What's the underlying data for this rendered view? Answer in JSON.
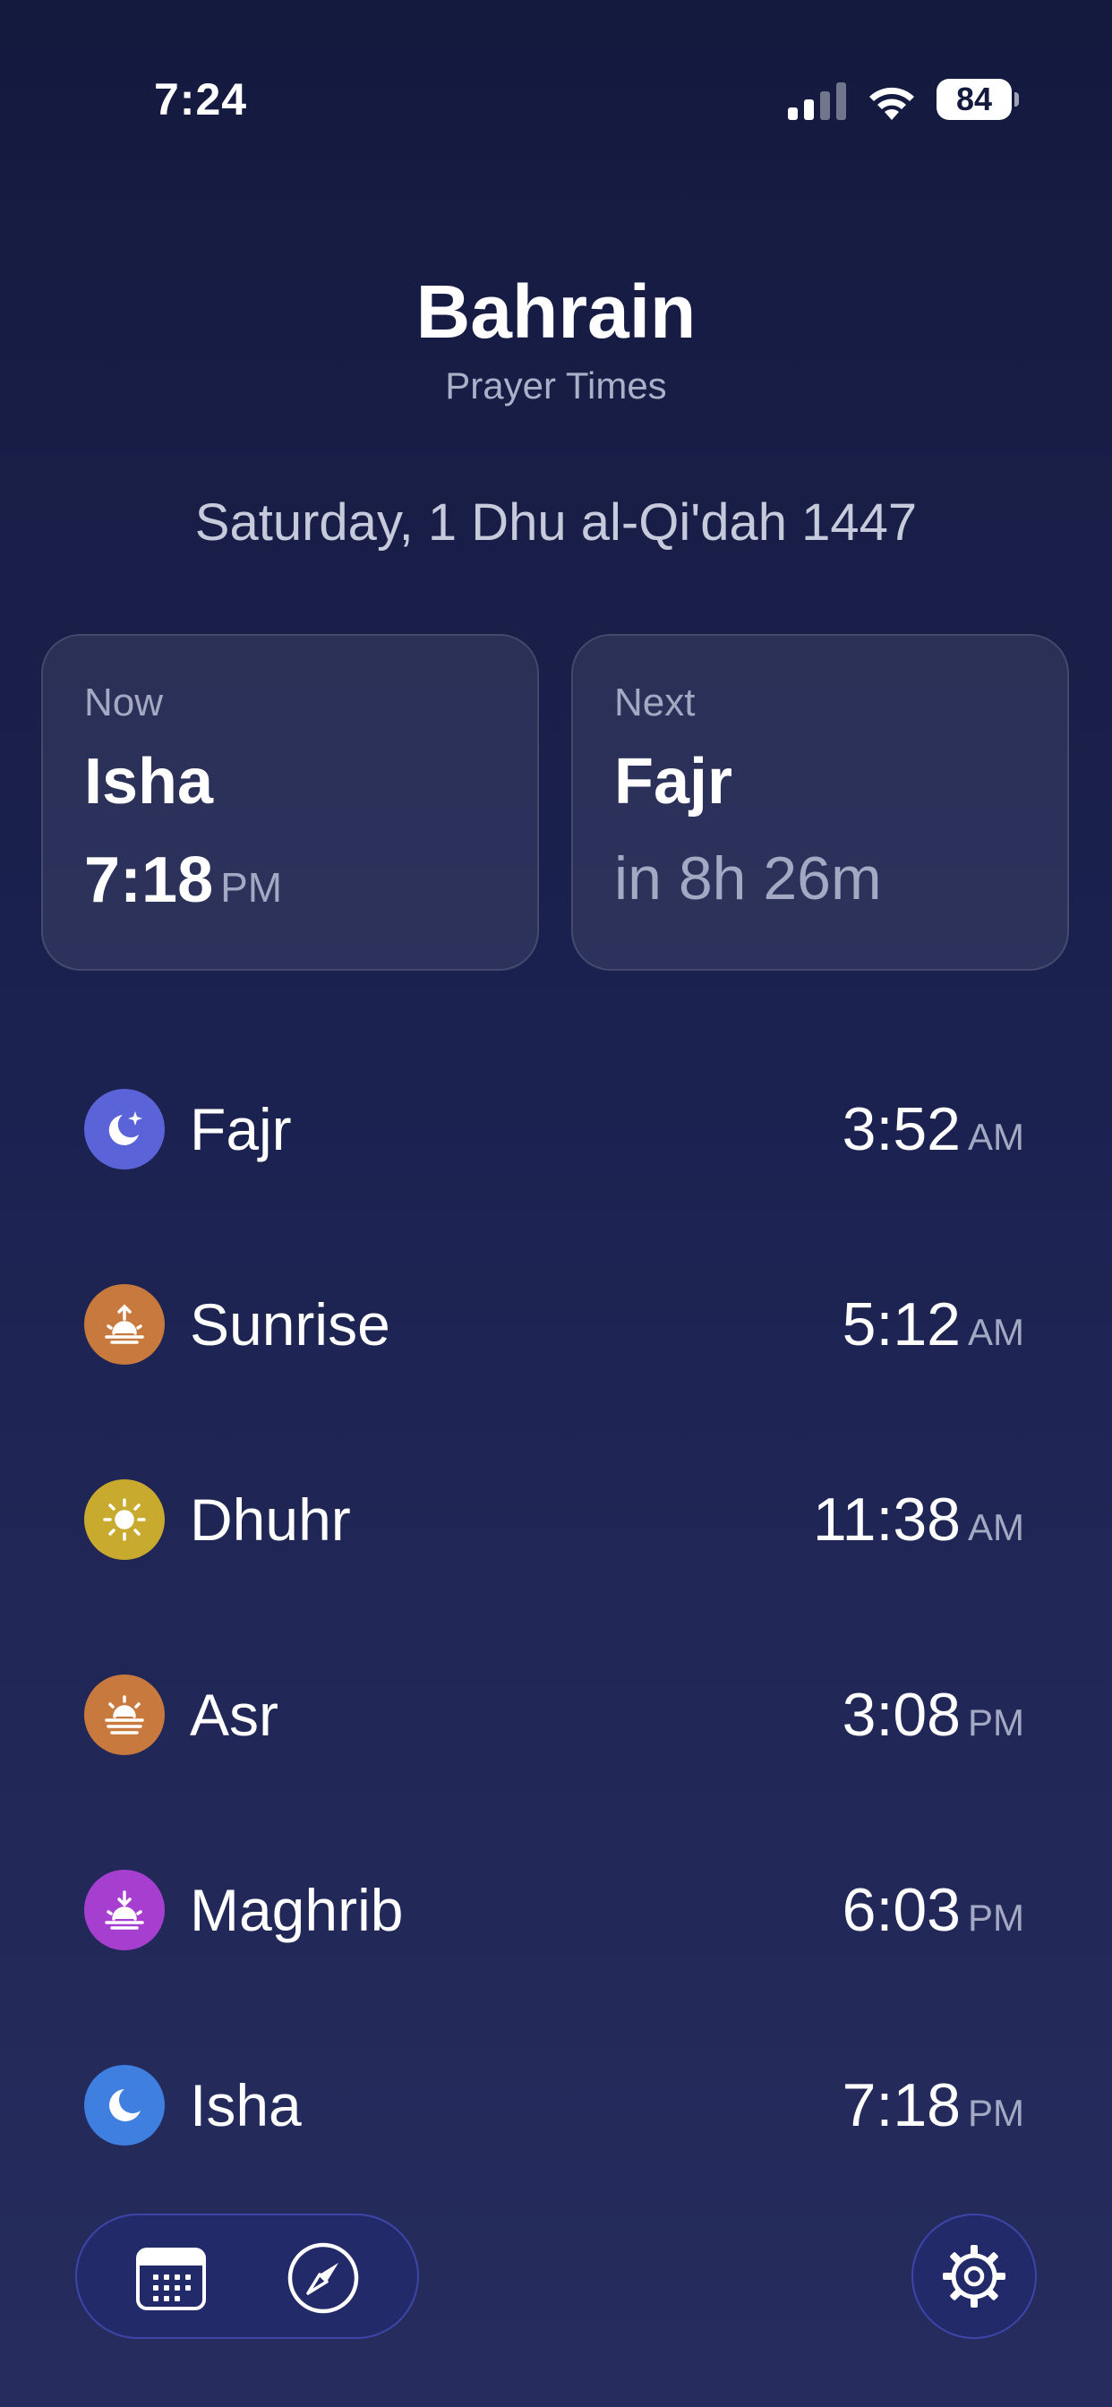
{
  "status_bar": {
    "time": "7:24",
    "battery_level": "84"
  },
  "header": {
    "city": "Bahrain",
    "subtitle": "Prayer Times",
    "hijri_date": "Saturday, 1 Dhu al-Qi'dah 1447"
  },
  "now_card": {
    "label": "Now",
    "prayer": "Isha",
    "time": "7:18",
    "period": "PM"
  },
  "next_card": {
    "label": "Next",
    "prayer": "Fajr",
    "countdown": "in 8h 26m"
  },
  "prayers": [
    {
      "name": "Fajr",
      "time": "3:52",
      "period": "AM",
      "icon": "moon-star-icon",
      "color": "#5b63d8"
    },
    {
      "name": "Sunrise",
      "time": "5:12",
      "period": "AM",
      "icon": "sunrise-icon",
      "color": "#c87a3e"
    },
    {
      "name": "Dhuhr",
      "time": "11:38",
      "period": "AM",
      "icon": "sun-icon",
      "color": "#c8aa2e"
    },
    {
      "name": "Asr",
      "time": "3:08",
      "period": "PM",
      "icon": "sun-haze-icon",
      "color": "#c87a3e"
    },
    {
      "name": "Maghrib",
      "time": "6:03",
      "period": "PM",
      "icon": "sunset-icon",
      "color": "#a63ed0"
    },
    {
      "name": "Isha",
      "time": "7:18",
      "period": "PM",
      "icon": "moon-icon",
      "color": "#3f7fe0"
    }
  ],
  "nav": {
    "calendar_icon": "calendar-icon",
    "compass_icon": "compass-icon",
    "settings_icon": "gear-icon"
  }
}
